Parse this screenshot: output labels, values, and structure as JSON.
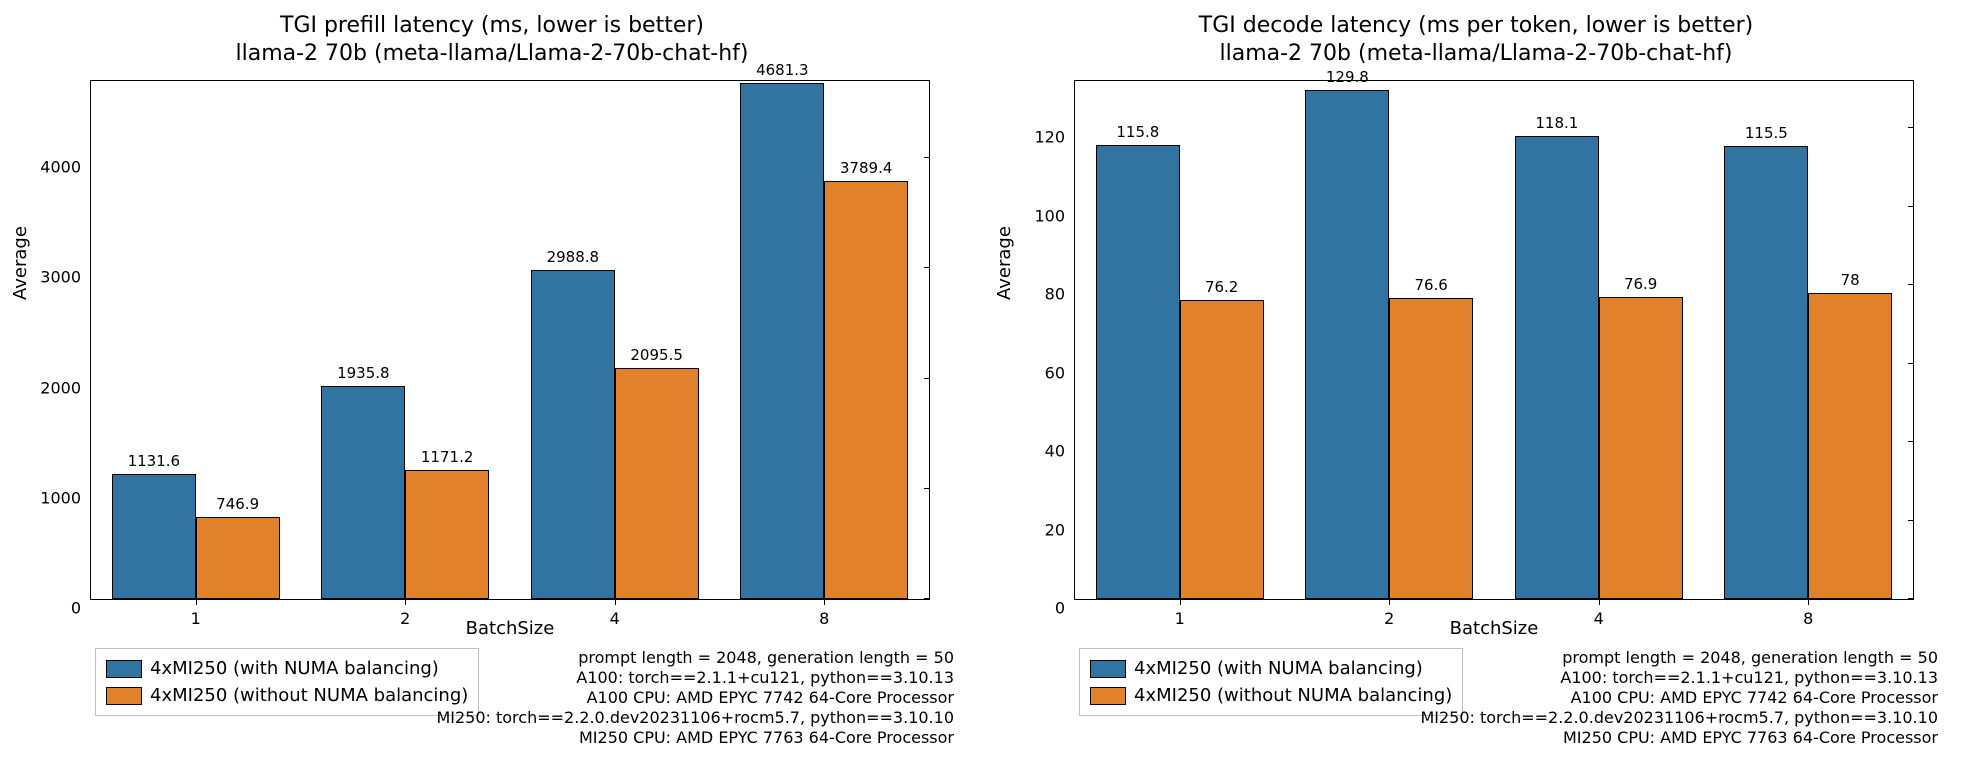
{
  "colors": {
    "series_a": "#3274a1",
    "series_b": "#e1812c"
  },
  "legend": {
    "a": "4xMI250 (with NUMA balancing)",
    "b": "4xMI250 (without NUMA balancing)"
  },
  "footer": {
    "l1": "prompt length = 2048, generation length = 50",
    "l2": "A100: torch==2.1.1+cu121, python==3.10.13",
    "l3": "A100 CPU: AMD EPYC 7742 64-Core Processor",
    "l4": "MI250: torch==2.2.0.dev20231106+rocm5.7, python==3.10.10",
    "l5": "MI250 CPU: AMD EPYC 7763 64-Core Processor"
  },
  "left": {
    "title_l1": "TGI prefill latency (ms, lower is better)",
    "title_l2": "llama-2 70b (meta-llama/Llama-2-70b-chat-hf)",
    "xlabel": "BatchSize",
    "ylabel": "Average",
    "yticks": [
      "0",
      "1000",
      "2000",
      "3000",
      "4000"
    ],
    "xticks": [
      "1",
      "2",
      "4",
      "8"
    ]
  },
  "right": {
    "title_l1": "TGI decode latency (ms per token, lower is better)",
    "title_l2": "llama-2 70b (meta-llama/Llama-2-70b-chat-hf)",
    "xlabel": "BatchSize",
    "ylabel": "Average",
    "yticks": [
      "0",
      "20",
      "40",
      "60",
      "80",
      "100",
      "120"
    ],
    "xticks": [
      "1",
      "2",
      "4",
      "8"
    ]
  },
  "chart_data": [
    {
      "id": "left",
      "type": "bar",
      "title": "TGI prefill latency (ms, lower is better)\nllama-2 70b (meta-llama/Llama-2-70b-chat-hf)",
      "xlabel": "BatchSize",
      "ylabel": "Average",
      "categories": [
        "1",
        "2",
        "4",
        "8"
      ],
      "series": [
        {
          "name": "4xMI250 (with NUMA balancing)",
          "values": [
            1131.6,
            1935.8,
            2988.8,
            4681.3
          ]
        },
        {
          "name": "4xMI250 (without NUMA balancing)",
          "values": [
            746.9,
            1171.2,
            2095.5,
            3789.4
          ]
        }
      ],
      "ylim": [
        0,
        4700
      ],
      "yticks": [
        0,
        1000,
        2000,
        3000,
        4000
      ]
    },
    {
      "id": "right",
      "type": "bar",
      "title": "TGI decode latency (ms per token, lower is better)\nllama-2 70b (meta-llama/Llama-2-70b-chat-hf)",
      "xlabel": "BatchSize",
      "ylabel": "Average",
      "categories": [
        "1",
        "2",
        "4",
        "8"
      ],
      "series": [
        {
          "name": "4xMI250 (with NUMA balancing)",
          "values": [
            115.8,
            129.8,
            118.1,
            115.5
          ]
        },
        {
          "name": "4xMI250 (without NUMA balancing)",
          "values": [
            76.2,
            76.6,
            76.9,
            78
          ]
        }
      ],
      "ylim": [
        0,
        132
      ],
      "yticks": [
        0,
        20,
        40,
        60,
        80,
        100,
        120
      ]
    }
  ]
}
